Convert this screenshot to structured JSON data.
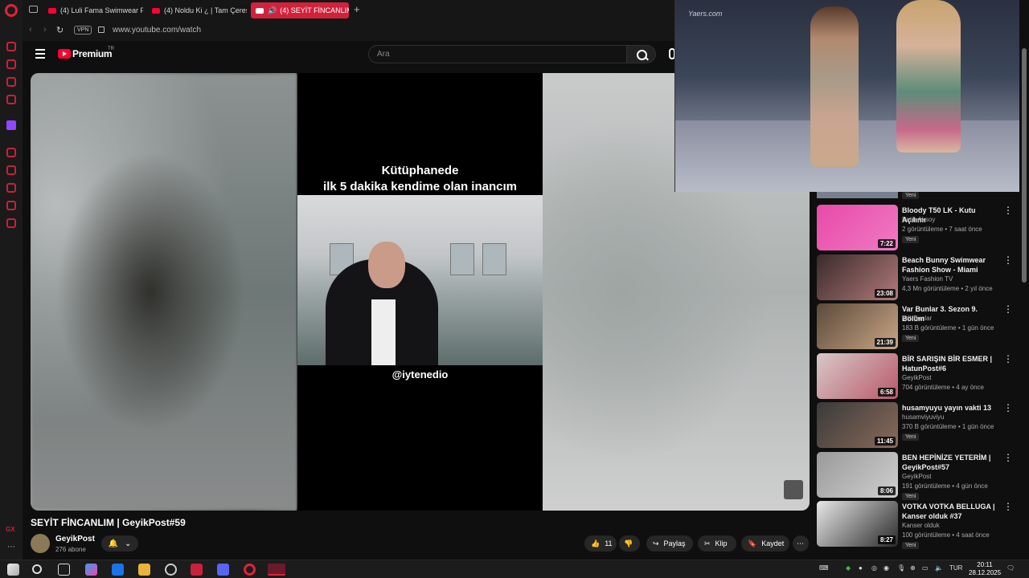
{
  "browser": {
    "tabs": [
      {
        "label": "(4) Luli Fama Swimwear F",
        "active": false
      },
      {
        "label": "(4) Noldu Ki ¿ | Tam Çeres",
        "active": false
      },
      {
        "label": "(4) SEYİT FİNCANLIM",
        "active": true
      }
    ],
    "vpn_label": "VPN",
    "url": "www.youtube.com/watch"
  },
  "youtube": {
    "brand": "Premium",
    "region": "TR",
    "search_placeholder": "Ara"
  },
  "video": {
    "caption_line1": "Kütüphanede",
    "caption_line2": "ilk 5 dakika kendime olan inancım",
    "handle": "@iytenedio",
    "title": "SEYİT FİNCANLIM | GeyikPost#59",
    "channel": "GeyikPost",
    "subscribers": "276 abone",
    "likes": "11",
    "share_label": "Paylaş",
    "clip_label": "Klip",
    "save_label": "Kaydet"
  },
  "miniplayer": {
    "watermark": "Yaers.com"
  },
  "recommendations": {
    "top_partial_badge": "Yeni",
    "items": [
      {
        "title": "Bloody T50 LK - Kutu Açılımı",
        "channel": "Fatih Aksoy",
        "meta": "2 görüntüleme • 7 saat önce",
        "badge": "Yeni",
        "duration": "7:22",
        "thumb": "linear-gradient(135deg,#e84aa8,#f07ac4)"
      },
      {
        "title": "Beach Bunny Swimwear Fashion Show - Miami Swim ...",
        "channel": "Yaers Fashion TV",
        "meta": "4,3 Mn görüntüleme • 2 yıl önce",
        "badge": "",
        "duration": "23:08",
        "thumb": "linear-gradient(135deg,#3a2a2a,#b27a7a)"
      },
      {
        "title": "Var Bunlar 3. Sezon 9. Bölüm",
        "channel": "Var Bunlar",
        "meta": "183 B görüntüleme • 1 gün önce",
        "badge": "Yeni",
        "duration": "21:39",
        "thumb": "linear-gradient(135deg,#5b4a3a,#c9a585)"
      },
      {
        "title": "BİR SARIŞIN BİR ESMER | HatunPost#6",
        "channel": "GeyikPost",
        "meta": "704 görüntüleme • 4 ay önce",
        "badge": "",
        "duration": "6:58",
        "thumb": "linear-gradient(135deg,#d8c8c8,#b85a6a)"
      },
      {
        "title": "husamyuyu yayın vakti 13",
        "channel": "husamviyuviyu",
        "meta": "370 B görüntüleme • 1 gün önce",
        "badge": "Yeni",
        "duration": "11:45",
        "thumb": "linear-gradient(135deg,#3a3a3a,#8a6a5a)"
      },
      {
        "title": "BEN HEPİNİZE YETERİM | GeyikPost#57",
        "channel": "GeyikPost",
        "meta": "191 görüntüleme • 4 gün önce",
        "badge": "Yeni",
        "duration": "8:06",
        "thumb": "linear-gradient(135deg,#9a9a9a,#cfcfcf)"
      },
      {
        "title": "VOTKA VOTKA BELLUGA | Kanser olduk #37",
        "channel": "Kanser olduk",
        "meta": "100 görüntüleme • 4 saat önce",
        "badge": "Yeni",
        "duration": "8:27",
        "thumb": "linear-gradient(135deg,#e8e8e8,#2a2a2a)"
      }
    ]
  },
  "taskbar": {
    "lang": "TUR",
    "time": "20:11",
    "date": "28.12.2025"
  },
  "sidebar": {
    "gx_label": "GX"
  }
}
